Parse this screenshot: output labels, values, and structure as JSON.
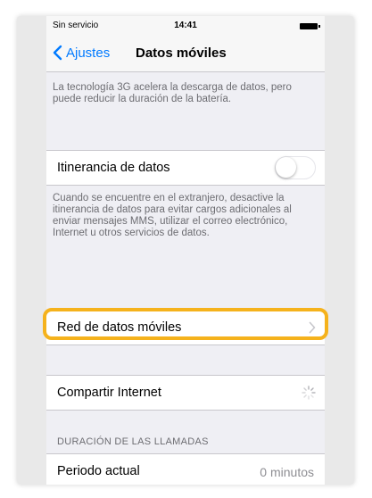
{
  "status_bar": {
    "carrier": "Sin servicio",
    "time": "14:41",
    "battery_icon": "battery-full-icon"
  },
  "nav": {
    "back_label": "Ajustes",
    "back_icon": "chevron-left-icon",
    "title": "Datos móviles"
  },
  "notes": {
    "three_g": "La tecnología 3G acelera la descarga de datos, pero puede reducir la duración de la batería.",
    "roaming": "Cuando se encuentre en el extranjero, desactive la itinerancia de datos para evitar cargos adicionales al enviar mensajes MMS, utilizar el correo electrónico, Internet u otros servicios de datos."
  },
  "cells": {
    "roaming": {
      "label": "Itinerancia de datos",
      "toggle_on": false
    },
    "network": {
      "label": "Red de datos móviles",
      "icon": "chevron-right-icon"
    },
    "hotspot": {
      "label": "Compartir Internet",
      "icon": "spinner-icon"
    },
    "current_period": {
      "label": "Periodo actual",
      "value": "0 minutos"
    }
  },
  "sections": {
    "call_duration": "DURACIÓN DE LAS LLAMADAS"
  },
  "colors": {
    "accent": "#007aff",
    "highlight": "#f5b21c",
    "background": "#efeff4"
  }
}
